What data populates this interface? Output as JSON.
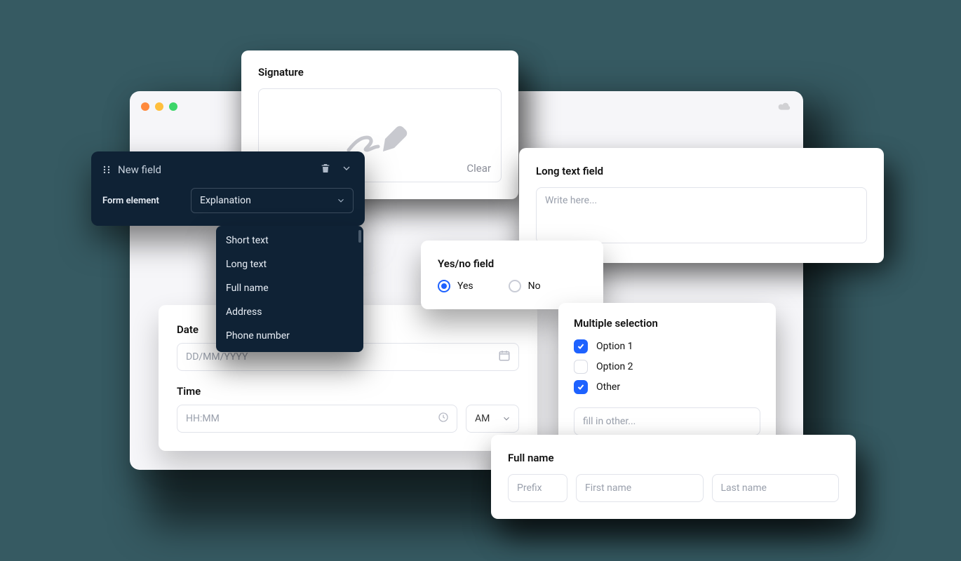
{
  "signature": {
    "title": "Signature",
    "clear": "Clear"
  },
  "longtext": {
    "title": "Long text field",
    "placeholder": "Write here..."
  },
  "yesno": {
    "title": "Yes/no field",
    "yes": "Yes",
    "no": "No"
  },
  "multi": {
    "title": "Multiple selection",
    "option1": "Option 1",
    "option2": "Option 2",
    "other": "Other",
    "other_placeholder": "fill in other..."
  },
  "fullname": {
    "title": "Full name",
    "prefix_placeholder": "Prefix",
    "first_placeholder": "First name",
    "last_placeholder": "Last name"
  },
  "datetime": {
    "date_title": "Date",
    "date_placeholder": "DD/MM/YYYY",
    "time_title": "Time",
    "time_placeholder": "HH:MM",
    "ampm": "AM"
  },
  "darkpanel": {
    "title": "New field",
    "label": "Form element",
    "selected": "Explanation"
  },
  "dropdown": {
    "items": {
      "0": "Short text",
      "1": "Long text",
      "2": "Full name",
      "3": "Address",
      "4": "Phone number"
    }
  }
}
